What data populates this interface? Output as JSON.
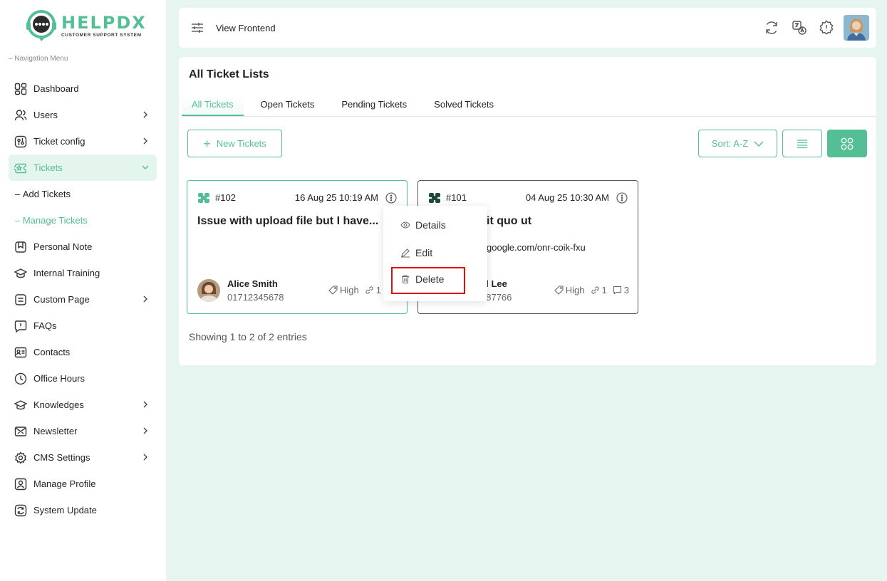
{
  "brand": {
    "title": "HELPDX",
    "subtitle": "CUSTOMER SUPPORT SYSTEM"
  },
  "sidebar": {
    "heading": "Navigation Menu",
    "items": [
      {
        "label": "Dashboard",
        "icon": "dashboard-icon"
      },
      {
        "label": "Users",
        "icon": "users-icon",
        "chevron": true
      },
      {
        "label": "Ticket config",
        "icon": "ticket-config-icon",
        "chevron": true
      },
      {
        "label": "Tickets",
        "icon": "ticket-icon",
        "chevron": true,
        "active": true
      },
      {
        "label": "Add Tickets",
        "sub": true
      },
      {
        "label": "Manage Tickets",
        "sub": true,
        "active": true
      },
      {
        "label": "Personal Note",
        "icon": "note-icon"
      },
      {
        "label": "Internal Training",
        "icon": "training-icon"
      },
      {
        "label": "Custom Page",
        "icon": "page-icon",
        "chevron": true
      },
      {
        "label": "FAQs",
        "icon": "faq-icon"
      },
      {
        "label": "Contacts",
        "icon": "contacts-icon"
      },
      {
        "label": "Office Hours",
        "icon": "clock-icon"
      },
      {
        "label": "Knowledges",
        "icon": "knowledge-icon",
        "chevron": true
      },
      {
        "label": "Newsletter",
        "icon": "newsletter-icon",
        "chevron": true
      },
      {
        "label": "CMS Settings",
        "icon": "settings-icon",
        "chevron": true
      },
      {
        "label": "Manage Profile",
        "icon": "profile-icon"
      },
      {
        "label": "System Update",
        "icon": "update-icon"
      }
    ]
  },
  "topbar": {
    "title": "View Frontend"
  },
  "main": {
    "title": "All Ticket Lists",
    "tabs": [
      "All Tickets",
      "Open Tickets",
      "Pending Tickets",
      "Solved Tickets"
    ],
    "new_button": "New Tickets",
    "sort_label": "Sort: A-Z",
    "showing": "Showing 1 to 2 of 2 entries"
  },
  "tickets": [
    {
      "id": "#102",
      "date": "16 Aug 25 10:19 AM",
      "subject": "Issue with upload file but I have...",
      "link": "",
      "name": "Alice Smith",
      "phone": "01712345678",
      "priority": "High",
      "attachments": "1",
      "replies": ""
    },
    {
      "id": "#101",
      "date": "04 Aug 25 10:30 AM",
      "subject": "it quo ut",
      "link": "google.com/onr-coik-fxu",
      "name": "el Lee",
      "phone": "387766",
      "priority": "High",
      "attachments": "1",
      "replies": "3"
    }
  ],
  "dropdown": {
    "details": "Details",
    "edit": "Edit",
    "delete": "Delete"
  },
  "colors": {
    "accent": "#54bf95",
    "highlight": "#e01010",
    "background": "#e6f5ef"
  }
}
